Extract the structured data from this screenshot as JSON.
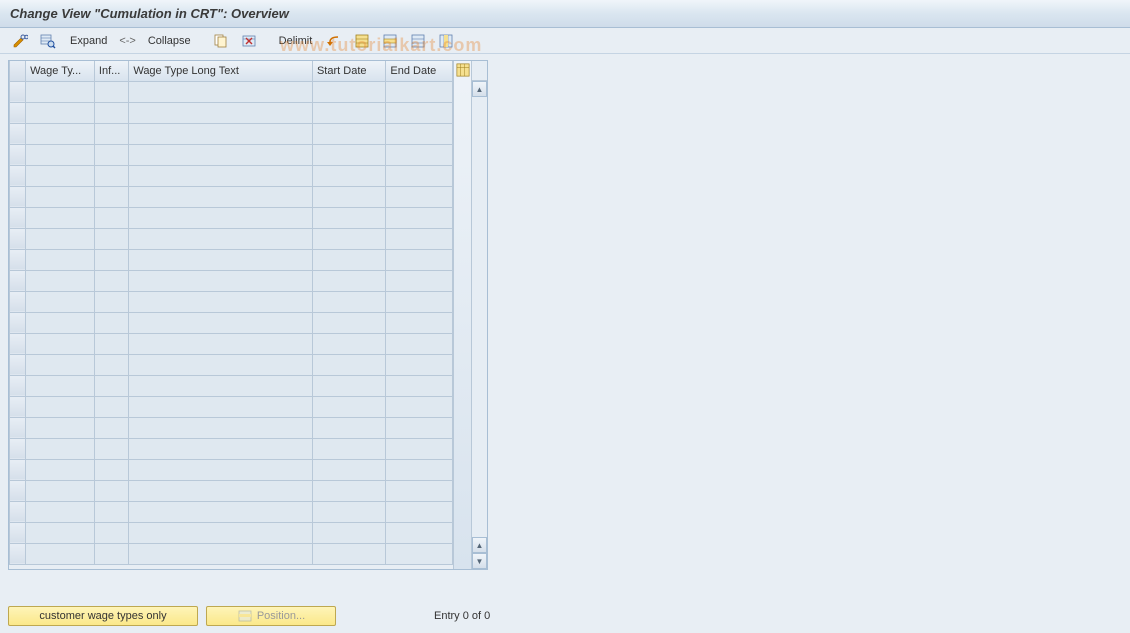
{
  "title": "Change View \"Cumulation in CRT\": Overview",
  "toolbar": {
    "expand_label": "Expand",
    "expand_sep": "<->",
    "collapse_label": "Collapse",
    "delimit_label": "Delimit"
  },
  "table": {
    "columns": {
      "wage_ty": "Wage Ty...",
      "inf": "Inf...",
      "long_text": "Wage Type Long Text",
      "start": "Start Date",
      "end": "End Date"
    },
    "row_count": 23
  },
  "footer": {
    "customer_btn": "customer wage types only",
    "position_btn": "Position...",
    "status": "Entry 0 of 0"
  },
  "watermark": "www.tutorialkart.com"
}
